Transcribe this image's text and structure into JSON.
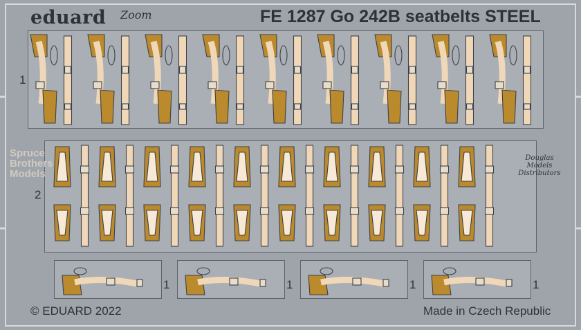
{
  "header": {
    "brand": "eduard",
    "brand_sub": "Zoom",
    "title": "FE 1287  Go 242B seatbelts STEEL"
  },
  "footer": {
    "copyright": "© EDUARD 2022",
    "origin": "Made in Czech Republic"
  },
  "part_numbers": {
    "row1": "1",
    "row2": "2",
    "small": "1"
  },
  "watermarks": {
    "left": [
      "Spruce",
      "Brothers",
      "Models"
    ],
    "right": [
      "Douglas",
      "Models",
      "Distributors"
    ]
  },
  "colors": {
    "steel": "#9ea4aa",
    "fret": "#a9afb5",
    "belt": "#f0d7b8",
    "pad": "#bb8a2c",
    "line": "#3c4147"
  },
  "sets": {
    "row1_count": 18,
    "row2_count": 20,
    "small_count": 4
  }
}
